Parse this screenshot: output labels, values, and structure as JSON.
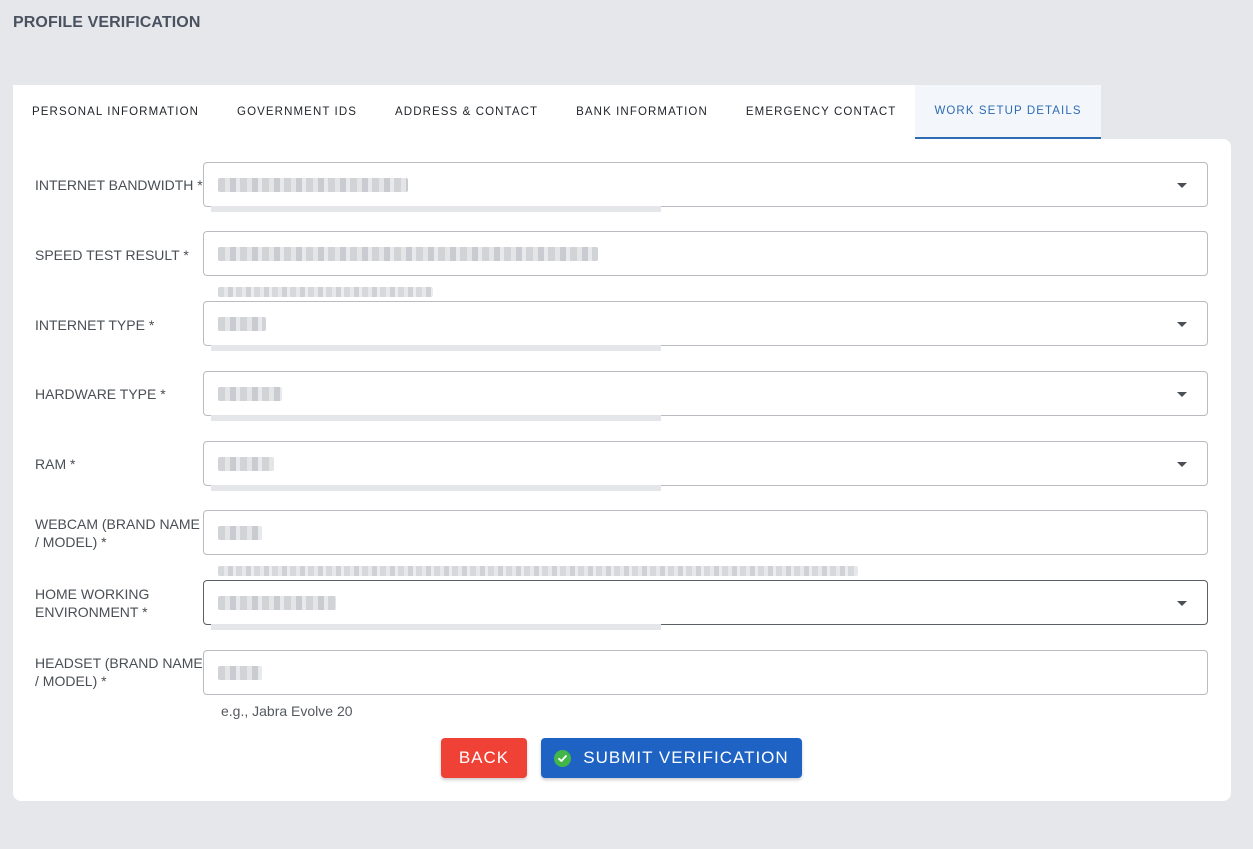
{
  "page": {
    "title": "PROFILE VERIFICATION"
  },
  "tabs": [
    {
      "label": "PERSONAL INFORMATION"
    },
    {
      "label": "GOVERNMENT IDS"
    },
    {
      "label": "ADDRESS & CONTACT"
    },
    {
      "label": "BANK INFORMATION"
    },
    {
      "label": "EMERGENCY CONTACT"
    },
    {
      "label": "WORK SETUP DETAILS",
      "active": true
    }
  ],
  "form": {
    "internet_bandwidth": {
      "label": "INTERNET BANDWIDTH *"
    },
    "speed_test_result": {
      "label": "SPEED TEST RESULT *"
    },
    "internet_type": {
      "label": "INTERNET TYPE *"
    },
    "hardware_type": {
      "label": "HARDWARE TYPE *"
    },
    "ram": {
      "label": "RAM *"
    },
    "webcam": {
      "label": "WEBCAM (BRAND NAME / MODEL) *"
    },
    "home_working_environment": {
      "label": "HOME WORKING ENVIRONMENT *"
    },
    "headset": {
      "label": "HEADSET (BRAND NAME / MODEL) *",
      "helper": "e.g., Jabra Evolve 20"
    }
  },
  "actions": {
    "back_label": "BACK",
    "submit_label": "SUBMIT VERIFICATION"
  },
  "colors": {
    "active_tab": "#2d6cb4",
    "back_button": "#ef4136",
    "submit_button": "#1e63c4",
    "check_icon": "#43b649"
  }
}
